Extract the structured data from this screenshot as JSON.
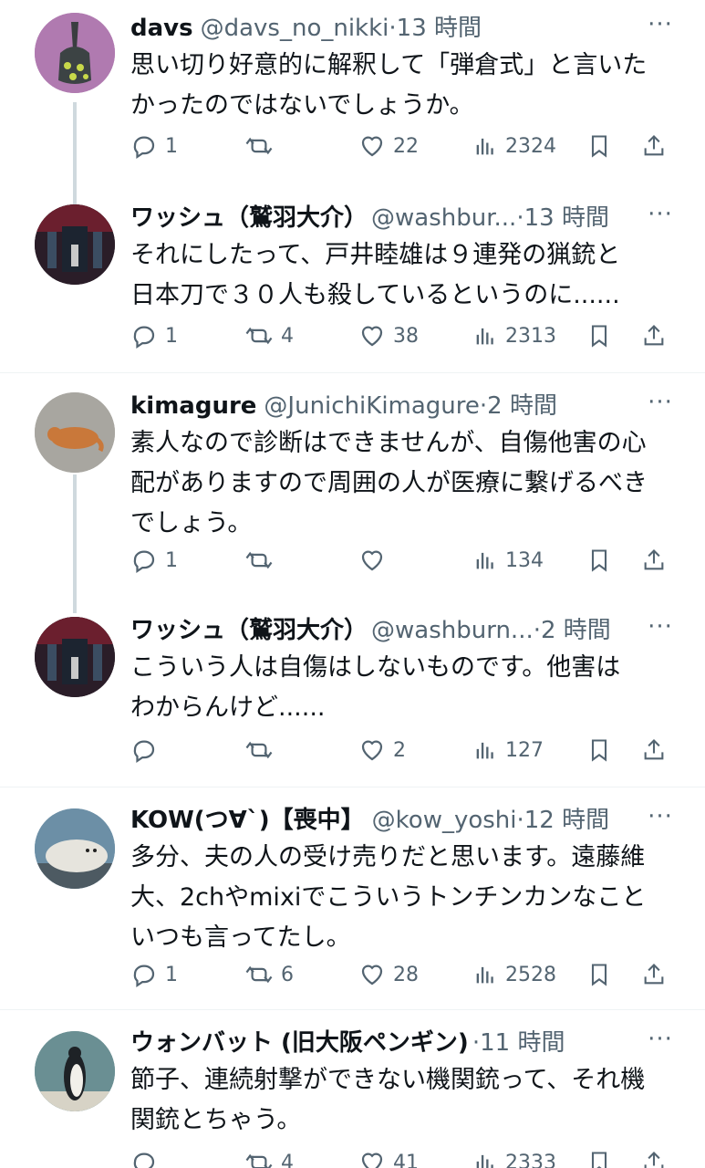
{
  "tweets": [
    {
      "name": "davs",
      "handle": "@davs_no_nikki",
      "dot": "·",
      "time": "13 時間",
      "text_lines": [
        "思い切り好意的に解釈して「弾倉式」と言いた",
        "かったのではないでしょうか。"
      ],
      "replies": "1",
      "retweets": "",
      "likes": "22",
      "views": "2324",
      "avatar_icon": "davs-avatar"
    },
    {
      "name": "ワッシュ（鷲羽大介）",
      "handle": "@washbur...",
      "dot": "·",
      "time": "13 時間",
      "text_lines": [
        "それにしたって、戸井睦雄は９連発の猟銃と",
        "日本刀で３０人も殺しているというのに......"
      ],
      "replies": "1",
      "retweets": "4",
      "likes": "38",
      "views": "2313",
      "avatar_icon": "washu-avatar"
    },
    {
      "name": "kimagure",
      "handle": "@JunichiKimagure",
      "dot": "·",
      "time": "2 時間",
      "text_lines": [
        "素人なので診断はできませんが、自傷他害の心",
        "配がありますので周囲の人が医療に繋げるべき",
        "でしょう。"
      ],
      "replies": "1",
      "retweets": "",
      "likes": "",
      "views": "134",
      "avatar_icon": "kimagure-avatar"
    },
    {
      "name": "ワッシュ（鷲羽大介）",
      "handle": "@washburn...",
      "dot": "·",
      "time": "2 時間",
      "text_lines": [
        "こういう人は自傷はしないものです。他害は",
        "わからんけど......"
      ],
      "replies": "",
      "retweets": "",
      "likes": "2",
      "views": "127",
      "avatar_icon": "washu-avatar"
    },
    {
      "name": "KOW(つ∀`)【喪中】",
      "handle": "@kow_yoshi",
      "dot": "·",
      "time": "12 時間",
      "text_lines": [
        "多分、夫の人の受け売りだと思います。遠藤維",
        "大、2chやmixiでこういうトンチンカンなこと",
        "いつも言ってたし。"
      ],
      "replies": "1",
      "retweets": "6",
      "likes": "28",
      "views": "2528",
      "avatar_icon": "kow-avatar"
    },
    {
      "name": "ウォンバット (旧大阪ペンギン)",
      "handle": "",
      "dot": "·",
      "time": "11 時間",
      "text_lines": [
        "節子、連続射撃ができない機関銃って、それ機",
        "関銃とちゃう。"
      ],
      "replies": "",
      "retweets": "4",
      "likes": "41",
      "views": "2333",
      "avatar_icon": "wombat-avatar"
    }
  ],
  "more_label": "···",
  "colors": {
    "text": "#0f1419",
    "secondary": "#536471",
    "divider": "#eff3f4",
    "thread": "#cfd9de"
  }
}
